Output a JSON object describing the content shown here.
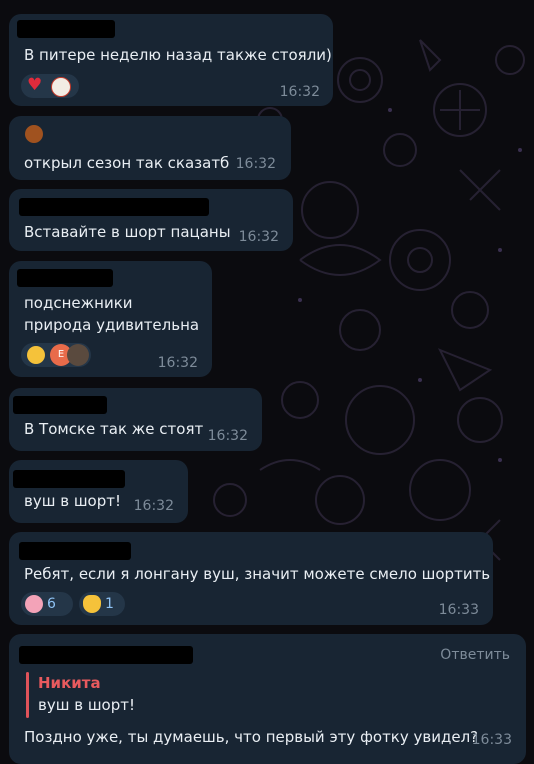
{
  "messages": [
    {
      "text": "В питере неделю назад также стояли)",
      "time": "16:32"
    },
    {
      "text": "открыл сезон так сказатб",
      "time": "16:32"
    },
    {
      "text": "Вставайте в шорт пацаны",
      "time": "16:32"
    },
    {
      "line1": "подснежники",
      "line2": "природа удивительна",
      "time": "16:32",
      "avatar_letter": "E"
    },
    {
      "text": "В Томске так же стоят",
      "time": "16:32"
    },
    {
      "text": "вуш в шорт!",
      "time": "16:32"
    },
    {
      "text": "Ребят, если я лонгану вуш, значит можете смело шортить",
      "time": "16:33",
      "reactions": [
        {
          "icon": "pig-emoji-icon",
          "count": "6"
        },
        {
          "icon": "ok-hand-emoji-icon",
          "count": "1"
        }
      ]
    },
    {
      "action": "Ответить",
      "reply_name": "Никита",
      "reply_text": "вуш в шорт!",
      "text": "Поздно уже, ты думаешь, что первый эту фотку увидел?",
      "time": "16:33"
    }
  ],
  "colors": {
    "bubble": "#182533",
    "background": "#0b0b0f",
    "reply_accent": "#e0535a",
    "time": "#7d8b99"
  }
}
